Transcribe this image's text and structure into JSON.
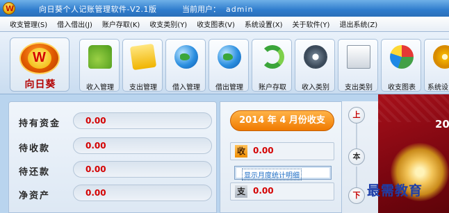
{
  "window": {
    "title": "向日葵个人记账管理软件-V2.1版",
    "current_user_label": "当前用户：",
    "current_user": "admin"
  },
  "menu": [
    "收支管理(S)",
    "借入借出(J)",
    "账户存取(K)",
    "收支类别(Y)",
    "收支图表(V)",
    "系统设置(X)",
    "关于软件(Y)",
    "退出系统(Z)"
  ],
  "logo": {
    "brand_text": "向日葵",
    "badge": "W"
  },
  "toolbar": [
    {
      "label": "收入管理",
      "icon": "money-stack-icon"
    },
    {
      "label": "支出管理",
      "icon": "gift-box-icon"
    },
    {
      "label": "借入管理",
      "icon": "globe-icon"
    },
    {
      "label": "借出管理",
      "icon": "globe-arrow-icon"
    },
    {
      "label": "账户存取",
      "icon": "refresh-arrows-icon"
    },
    {
      "label": "收入类别",
      "icon": "gear-monitor-icon"
    },
    {
      "label": "支出类别",
      "icon": "documents-gear-icon"
    },
    {
      "label": "收支图表",
      "icon": "pie-chart-icon"
    },
    {
      "label": "系统设",
      "icon": "cog-icon"
    }
  ],
  "summary": [
    {
      "label": "持有资金",
      "value": "0.00"
    },
    {
      "label": "待收款",
      "value": "0.00"
    },
    {
      "label": "待还款",
      "value": "0.00"
    },
    {
      "label": "净资产",
      "value": "0.00"
    }
  ],
  "monthly": {
    "year": "2014",
    "year_suffix": "年",
    "month": "4",
    "month_suffix": "月份收支",
    "income_tag": "收",
    "income_value": "0.00",
    "detail_button": "显示月度统计明细",
    "expense_tag": "支",
    "expense_value": "0.00"
  },
  "nav": {
    "up": "上",
    "middle": "本",
    "down": "下"
  },
  "banner": {
    "year_text": "20"
  },
  "watermark": "最需教育"
}
